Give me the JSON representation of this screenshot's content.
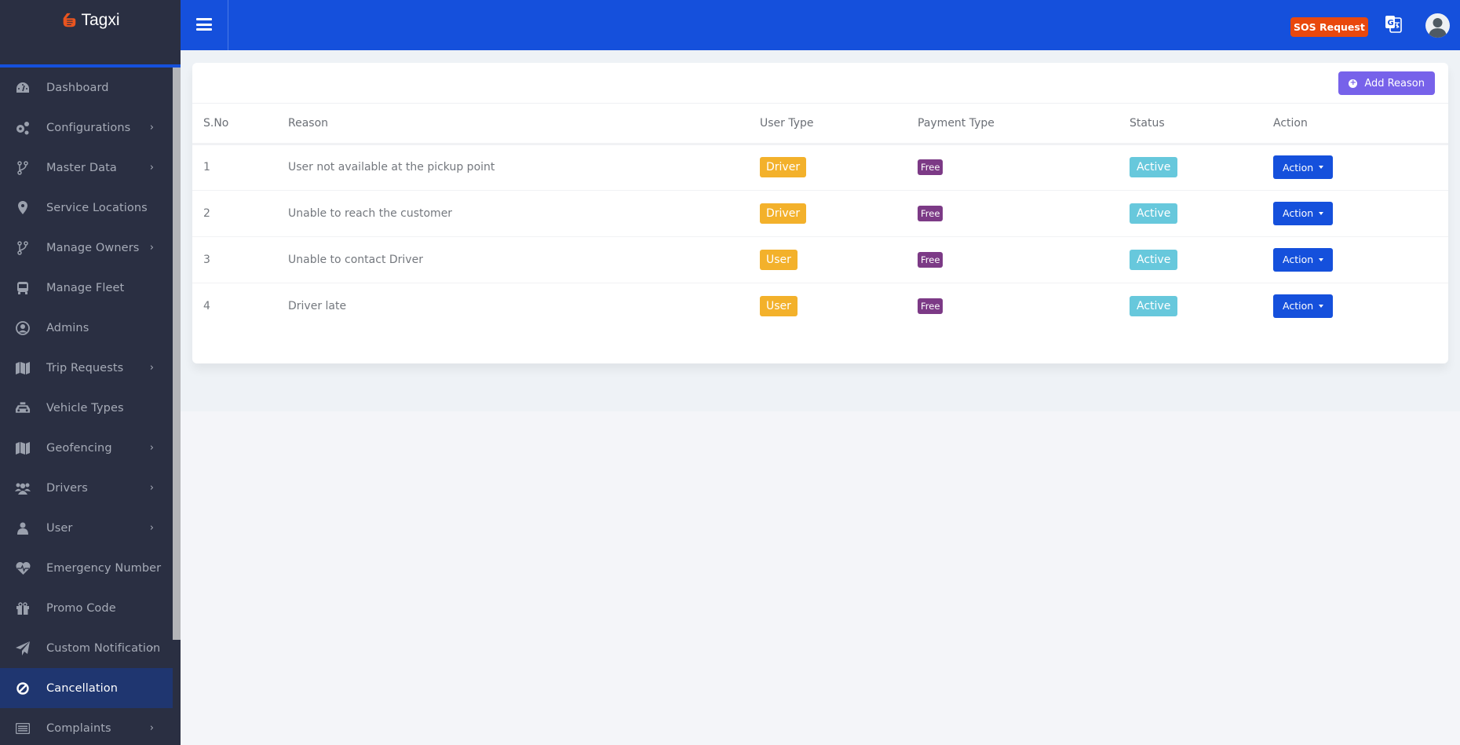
{
  "app": {
    "brand": "Tagxi",
    "colors": {
      "header": "#1550dc",
      "sidebar": "#2a2f42",
      "sidebar_active": "#1f3670",
      "sos": "#e9480d",
      "add_button": "#7762ea",
      "user_type_badge": "#f3b12b",
      "payment_badge": "#7c3a86",
      "status_badge": "#67c8dc",
      "action_button": "#1550dc"
    }
  },
  "header": {
    "sos_label": "SOS Request",
    "menu_icon": "hamburger-icon",
    "translate_icon": "translate-icon",
    "avatar_icon": "user-avatar-icon"
  },
  "sidebar": {
    "items": [
      {
        "label": "Dashboard",
        "icon": "dashboard-gauge-icon",
        "has_submenu": false
      },
      {
        "label": "Configurations",
        "icon": "cogs-icon",
        "has_submenu": true
      },
      {
        "label": "Master Data",
        "icon": "code-branch-icon",
        "has_submenu": true
      },
      {
        "label": "Service Locations",
        "icon": "map-marker-icon",
        "has_submenu": false
      },
      {
        "label": "Manage Owners",
        "icon": "code-branch-icon",
        "has_submenu": true
      },
      {
        "label": "Manage Fleet",
        "icon": "bus-icon",
        "has_submenu": false
      },
      {
        "label": "Admins",
        "icon": "user-circle-icon",
        "has_submenu": false
      },
      {
        "label": "Trip Requests",
        "icon": "map-icon",
        "has_submenu": true
      },
      {
        "label": "Vehicle Types",
        "icon": "taxi-icon",
        "has_submenu": false
      },
      {
        "label": "Geofencing",
        "icon": "map-icon",
        "has_submenu": true
      },
      {
        "label": "Drivers",
        "icon": "users-icon",
        "has_submenu": true
      },
      {
        "label": "User",
        "icon": "user-icon",
        "has_submenu": true
      },
      {
        "label": "Emergency Number",
        "icon": "heartbeat-icon",
        "has_submenu": false
      },
      {
        "label": "Promo Code",
        "icon": "gift-icon",
        "has_submenu": false
      },
      {
        "label": "Custom Notification",
        "icon": "paper-plane-icon",
        "has_submenu": true
      },
      {
        "label": "Cancellation",
        "icon": "ban-icon",
        "has_submenu": false,
        "active": true
      },
      {
        "label": "Complaints",
        "icon": "list-alt-icon",
        "has_submenu": true
      }
    ]
  },
  "main": {
    "add_button_label": "Add Reason",
    "table": {
      "columns": [
        "S.No",
        "Reason",
        "User Type",
        "Payment Type",
        "Status",
        "Action"
      ],
      "rows": [
        {
          "sno": "1",
          "reason": "User not available at the pickup point",
          "user_type": "Driver",
          "payment_type": "Free",
          "status": "Active",
          "action": "Action"
        },
        {
          "sno": "2",
          "reason": "Unable to reach the customer",
          "user_type": "Driver",
          "payment_type": "Free",
          "status": "Active",
          "action": "Action"
        },
        {
          "sno": "3",
          "reason": "Unable to contact Driver",
          "user_type": "User",
          "payment_type": "Free",
          "status": "Active",
          "action": "Action"
        },
        {
          "sno": "4",
          "reason": "Driver late",
          "user_type": "User",
          "payment_type": "Free",
          "status": "Active",
          "action": "Action"
        }
      ]
    }
  }
}
